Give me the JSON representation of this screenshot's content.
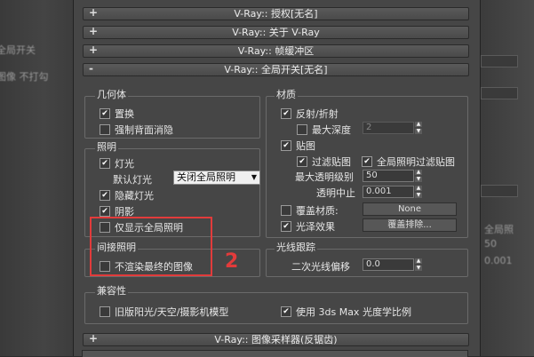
{
  "background_left": {
    "ghost_1": "全局开关",
    "ghost_2": "图像 不打勾"
  },
  "background_right": {
    "ghost_1": "全局照",
    "ghost_2": "50",
    "ghost_3": "0.001"
  },
  "rollouts_top": [
    {
      "sign": "+",
      "title": "V-Ray:: 授权[无名]"
    },
    {
      "sign": "+",
      "title": "V-Ray:: 关于 V-Ray"
    },
    {
      "sign": "+",
      "title": "V-Ray:: 帧缓冲区"
    },
    {
      "sign": "-",
      "title": "V-Ray:: 全局开关[无名]"
    }
  ],
  "geometry": {
    "title": "几何体",
    "displacement": {
      "label": "置换",
      "checked": true
    },
    "force_backface": {
      "label": "强制背面消隐",
      "checked": false
    }
  },
  "lighting": {
    "title": "照明",
    "lights": {
      "label": "灯光",
      "checked": true
    },
    "default_lights_label": "默认灯光",
    "default_lights_value": "关闭全局照明",
    "hidden_lights": {
      "label": "隐藏灯光",
      "checked": true
    },
    "shadows": {
      "label": "阴影",
      "checked": true
    },
    "show_gi_only": {
      "label": "仅显示全局照明",
      "checked": false
    }
  },
  "materials": {
    "title": "材质",
    "reflection": {
      "label": "反射/折射",
      "checked": true
    },
    "max_depth": {
      "label": "最大深度",
      "checked": false,
      "value": "2"
    },
    "maps": {
      "label": "贴图",
      "checked": true
    },
    "filter_maps": {
      "label": "过滤贴图",
      "checked": true
    },
    "gi_filter_maps": {
      "label": "全局照明过滤贴图",
      "checked": true
    },
    "max_transp_label": "最大透明级别",
    "max_transp_value": "50",
    "transp_cutoff_label": "透明中止",
    "transp_cutoff_value": "0.001",
    "override_mtl": {
      "label": "覆盖材质:",
      "checked": false
    },
    "override_btn": "None",
    "glossy": {
      "label": "光泽效果",
      "checked": true
    },
    "exclude_btn": "覆盖排除..."
  },
  "indirect": {
    "title": "间接照明",
    "dont_render_final": {
      "label": "不渲染最终的图像",
      "checked": false
    },
    "annotation": "2",
    "highlight_color": "#e23b3b"
  },
  "raytracing": {
    "title": "光线跟踪",
    "secondary_bias_label": "二次光线偏移",
    "secondary_bias_value": "0.0"
  },
  "compat": {
    "title": "兼容性",
    "legacy_sun": {
      "label": "旧版阳光/天空/摄影机模型",
      "checked": false
    },
    "use_3dsmax": {
      "label": "使用 3ds Max 光度学比例",
      "checked": true
    }
  },
  "rollouts_bottom": [
    {
      "sign": "+",
      "title": "V-Ray:: 图像采样器(反锯齿)"
    }
  ]
}
